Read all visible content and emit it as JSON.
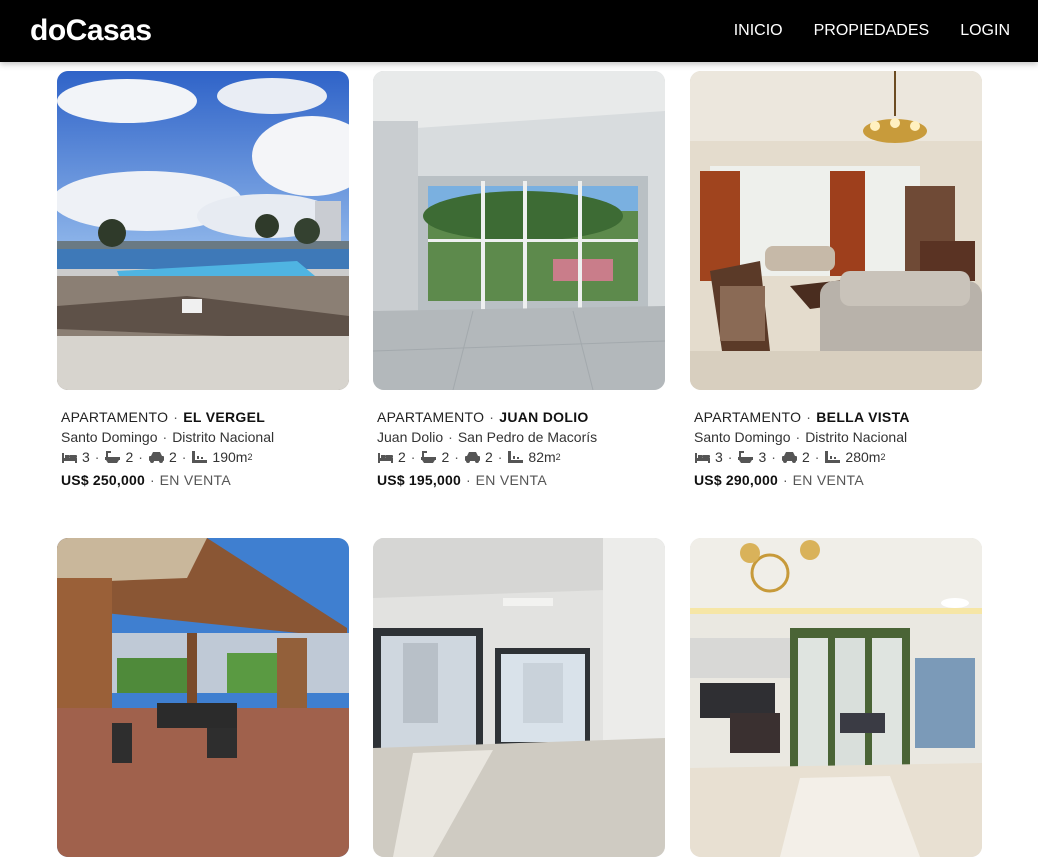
{
  "navbar": {
    "brand": "doCasas",
    "links": [
      {
        "label": "INICIO"
      },
      {
        "label": "PROPIEDADES"
      },
      {
        "label": "LOGIN"
      }
    ]
  },
  "listings": [
    {
      "type": "APARTAMENTO",
      "name": "EL VERGEL",
      "city": "Santo Domingo",
      "province": "Distrito Nacional",
      "beds": "3",
      "baths": "2",
      "parking": "2",
      "area": "190m",
      "area_sup": "2",
      "price": "US$ 250,000",
      "status": "EN VENTA",
      "photo_icon": "rooftop-pool-photo"
    },
    {
      "type": "APARTAMENTO",
      "name": "JUAN DOLIO",
      "city": "Juan Dolio",
      "province": "San Pedro de Macorís",
      "beds": "2",
      "baths": "2",
      "parking": "2",
      "area": "82m",
      "area_sup": "2",
      "price": "US$ 195,000",
      "status": "EN VENTA",
      "photo_icon": "empty-room-balcony-photo"
    },
    {
      "type": "APARTAMENTO",
      "name": "BELLA VISTA",
      "city": "Santo Domingo",
      "province": "Distrito Nacional",
      "beds": "3",
      "baths": "3",
      "parking": "2",
      "area": "280m",
      "area_sup": "2",
      "price": "US$ 290,000",
      "status": "EN VENTA",
      "photo_icon": "living-room-photo"
    },
    {
      "photo_icon": "pergola-terrace-photo"
    },
    {
      "photo_icon": "empty-living-room-photo"
    },
    {
      "photo_icon": "kitchen-dining-photo"
    }
  ],
  "colors": {
    "navbar_bg": "#000000",
    "page_bg": "#ffffff"
  }
}
